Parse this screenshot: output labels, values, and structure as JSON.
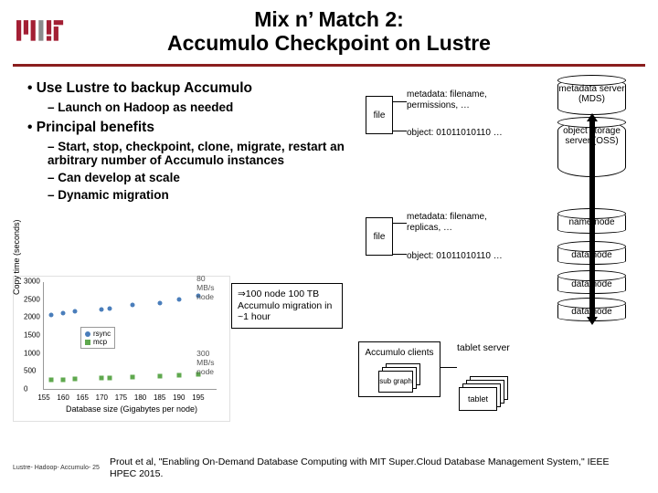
{
  "title_line1": "Mix n’ Match 2:",
  "title_line2": "Accumulo Checkpoint on Lustre",
  "bullets": {
    "b1": "Use Lustre to backup Accumulo",
    "b1a": "Launch on Hadoop as needed",
    "b2": "Principal benefits",
    "b2a": "Start, stop, checkpoint, clone, migrate, restart an arbitrary number of Accumulo instances",
    "b2b": "Can develop at scale",
    "b2c": "Dynamic migration"
  },
  "file_label": "file",
  "meta1": "metadata: filename, permissions, …",
  "obj1": "object: 01011010110 …",
  "meta2": "metadata: filename, replicas, …",
  "obj2": "object: 01011010110 …",
  "cyl": {
    "mds": "metadata server (MDS)",
    "oss": "object storage server (OSS)",
    "nn": "name node",
    "dn": "data node"
  },
  "callout": "⇒100 node 100 TB Accumulo migration in ~1 hour",
  "acc_clients": "Accumulo clients",
  "sub_graph": "sub graph",
  "tablet_server": "tablet server",
  "tablet": "tablet",
  "footer_left": "Lustre- Hadoop- Accumulo- 25",
  "footer_cite": "Prout et al, \"Enabling On-Demand Database Computing with MIT Super.Cloud Database Management System,\" IEEE HPEC 2015.",
  "chart_data": {
    "type": "scatter",
    "xlabel": "Database size (Gigabytes per node)",
    "ylabel": "Copy time (seconds)",
    "xlim": [
      155,
      200
    ],
    "ylim": [
      0,
      3000
    ],
    "x_ticks": [
      155,
      160,
      165,
      170,
      175,
      180,
      185,
      190,
      195
    ],
    "y_ticks": [
      0,
      500,
      1000,
      1500,
      2000,
      2500,
      3000
    ],
    "series": [
      {
        "name": "rsync",
        "color": "#4a7ebb",
        "x": [
          157,
          160,
          163,
          170,
          172,
          178,
          185,
          190,
          195
        ],
        "y": [
          2050,
          2100,
          2150,
          2200,
          2250,
          2350,
          2400,
          2500,
          2600
        ]
      },
      {
        "name": "mcp",
        "color": "#5fa84e",
        "x": [
          157,
          160,
          163,
          170,
          172,
          178,
          185,
          190,
          195
        ],
        "y": [
          250,
          260,
          280,
          300,
          310,
          340,
          360,
          380,
          400
        ]
      }
    ],
    "annotations": [
      {
        "text": "80 MB/s node",
        "x": 196,
        "y": 2550
      },
      {
        "text": "300 MB/s node",
        "x": 196,
        "y": 450
      }
    ]
  }
}
